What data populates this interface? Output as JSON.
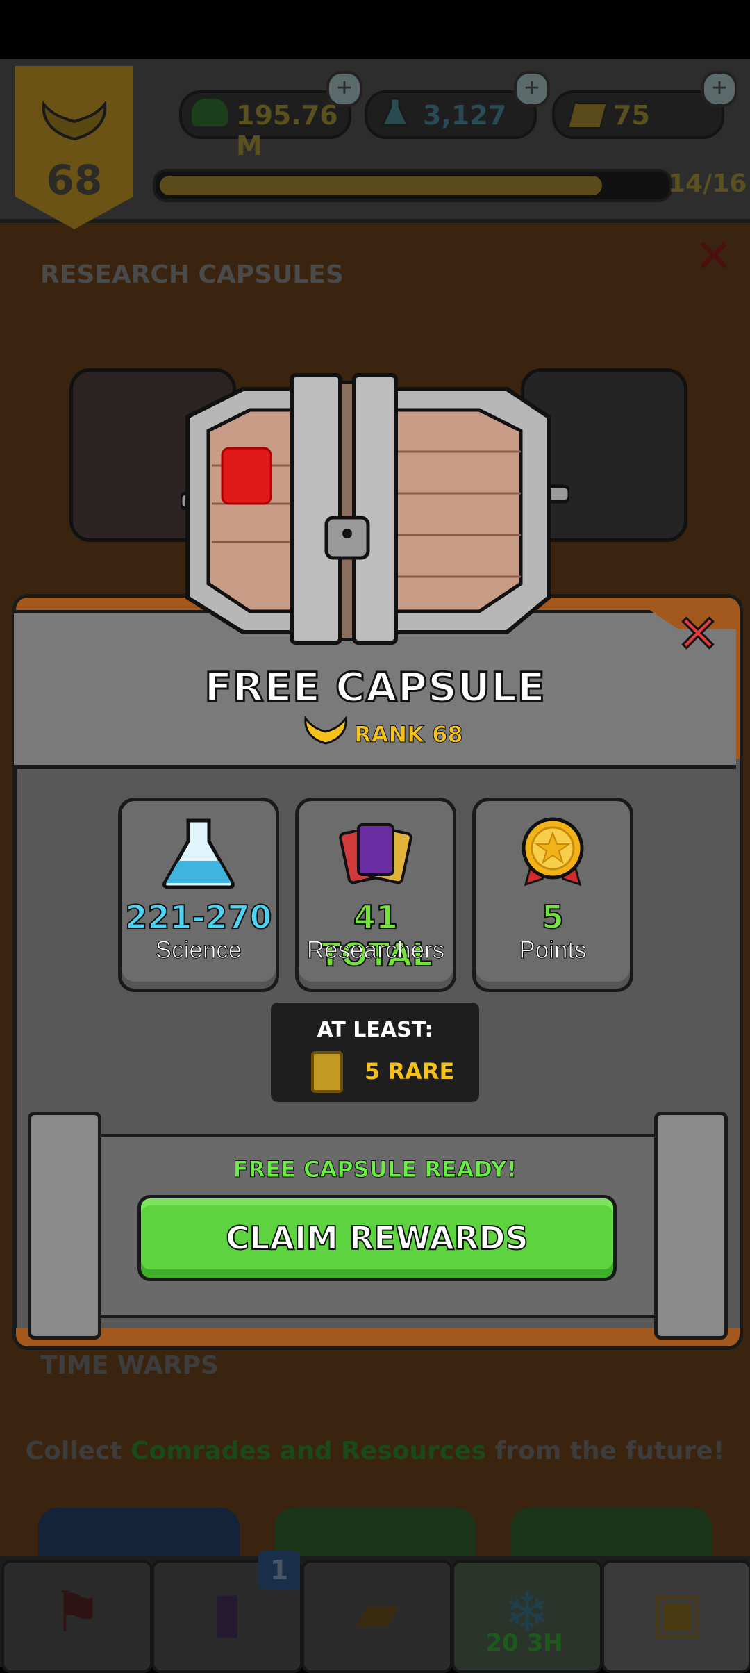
{
  "header": {
    "rank": "68",
    "currency_money": "195.76 M",
    "currency_science": "3,127",
    "currency_tickets": "75",
    "xp_progress": "14/16",
    "xp_fraction": 0.875,
    "section_title": "RESEARCH CAPSULES"
  },
  "background": {
    "time_warps_title": "TIME WARPS",
    "collect_prefix": "Collect ",
    "collect_highlight": "Comrades and Resources",
    "collect_suffix": " from the future!"
  },
  "dialog": {
    "title": "FREE CAPSULE",
    "rank_label": "RANK 68",
    "stats": [
      {
        "value": "221-270",
        "label": "Science",
        "color": "#4fd3f2",
        "icon": "flask-icon"
      },
      {
        "value": "41 TOTAL",
        "label": "Researchers",
        "color": "#74e33c",
        "icon": "cards-icon"
      },
      {
        "value": "5",
        "label": "Points",
        "color": "#74e33c",
        "icon": "medal-icon"
      }
    ],
    "at_least_title": "AT LEAST:",
    "at_least_value": "5 RARE",
    "ready_text": "FREE CAPSULE READY!",
    "claim_button": "CLAIM REWARDS"
  },
  "nav": {
    "badge_count": "1",
    "timer": "20 3H",
    "tabs": [
      "flag-icon",
      "cards-icon",
      "folder-icon",
      "snowflake-icon",
      "capsule-icon"
    ]
  },
  "colors": {
    "claim_green": "#5cd33f",
    "close_red": "#e23b3b",
    "rank_gold": "#f5c21b"
  }
}
